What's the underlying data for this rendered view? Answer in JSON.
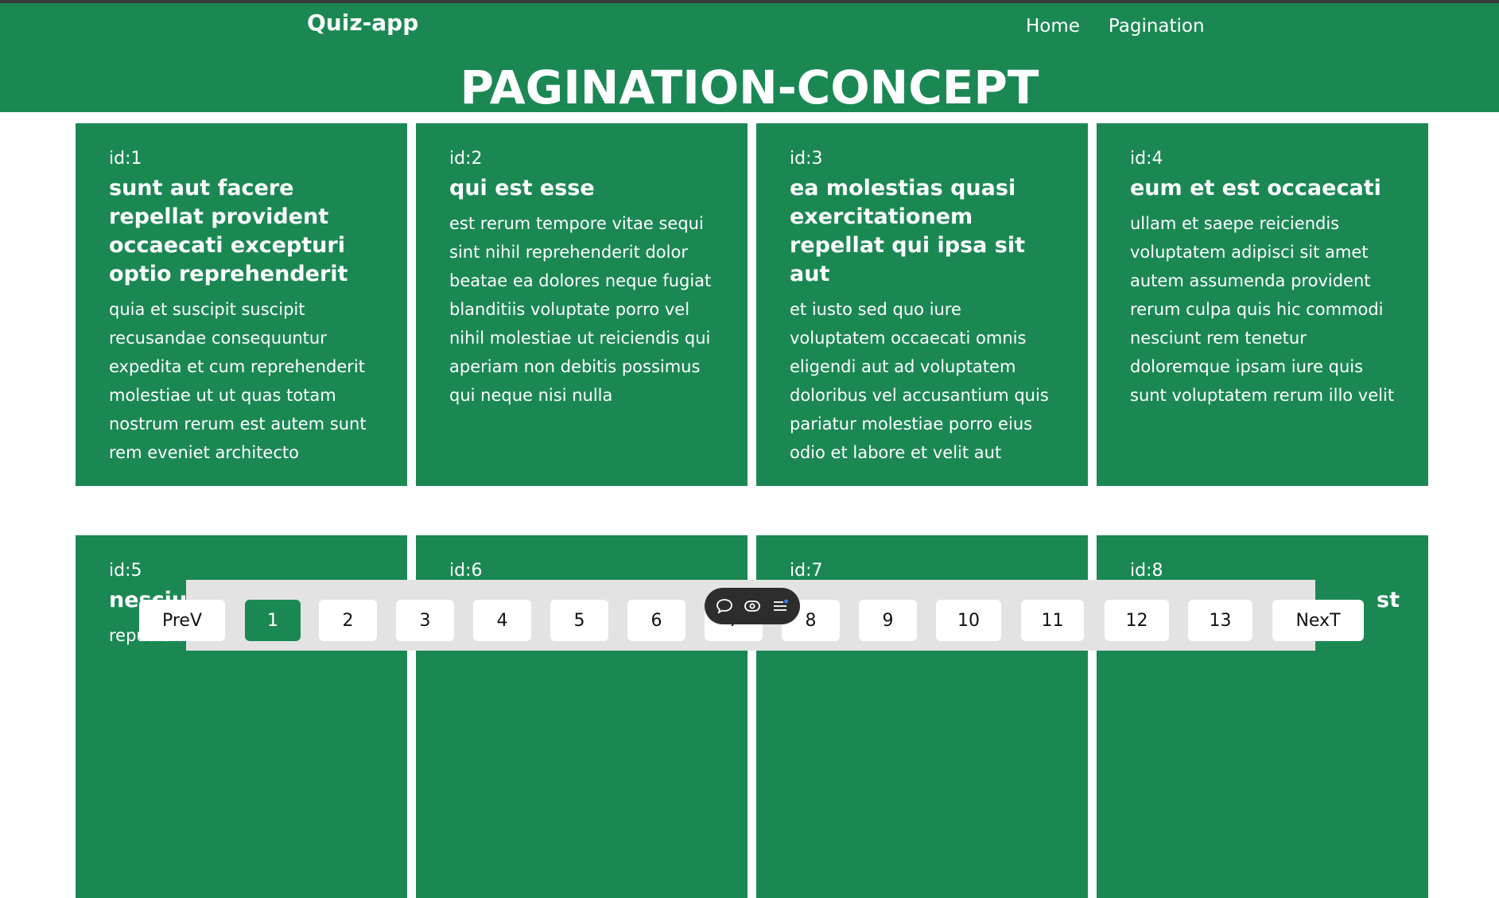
{
  "app": {
    "brand": "Quiz-app",
    "nav": [
      {
        "label": "Home"
      },
      {
        "label": "Pagination"
      }
    ],
    "title": "PAGINATION-CONCEPT"
  },
  "cards": [
    {
      "id": "id:1",
      "title": "sunt aut facere repellat provident occaecati excepturi optio reprehenderit",
      "body": "quia et suscipit suscipit recusandae consequuntur expedita et cum reprehenderit molestiae ut ut quas totam nostrum rerum est autem sunt rem eveniet architecto"
    },
    {
      "id": "id:2",
      "title": "qui est esse",
      "body": "est rerum tempore vitae sequi sint nihil reprehenderit dolor beatae ea dolores neque fugiat blanditiis voluptate porro vel nihil molestiae ut reiciendis qui aperiam non debitis possimus qui neque nisi nulla"
    },
    {
      "id": "id:3",
      "title": "ea molestias quasi exercitationem repellat qui ipsa sit aut",
      "body": "et iusto sed quo iure voluptatem occaecati omnis eligendi aut ad voluptatem doloribus vel accusantium quis pariatur molestiae porro eius odio et labore et velit aut"
    },
    {
      "id": "id:4",
      "title": "eum et est occaecati",
      "body": "ullam et saepe reiciendis voluptatem adipisci sit amet autem assumenda provident rerum culpa quis hic commodi nesciunt rem tenetur doloremque ipsam iure quis sunt voluptatem rerum illo velit"
    },
    {
      "id": "id:5",
      "title": "nesciunt",
      "body": "repudiandae"
    },
    {
      "id": "id:6",
      "title": "",
      "body": ""
    },
    {
      "id": "id:7",
      "title": "",
      "body": ""
    },
    {
      "id": "id:8",
      "title": "st",
      "body": ""
    }
  ],
  "pagination": {
    "prev_label": "PreV",
    "next_label": "NexT",
    "pages": [
      "1",
      "2",
      "3",
      "4",
      "5",
      "6",
      "7",
      "8",
      "9",
      "10",
      "11",
      "12",
      "13"
    ],
    "active_page": "1"
  },
  "toolbar": {
    "icons": [
      "chat-icon",
      "eye-icon",
      "menu-icon"
    ]
  },
  "colors": {
    "primary": "#1b8854",
    "pager_background": "#e3e3e3",
    "toolbar": "#2d2d2d"
  }
}
